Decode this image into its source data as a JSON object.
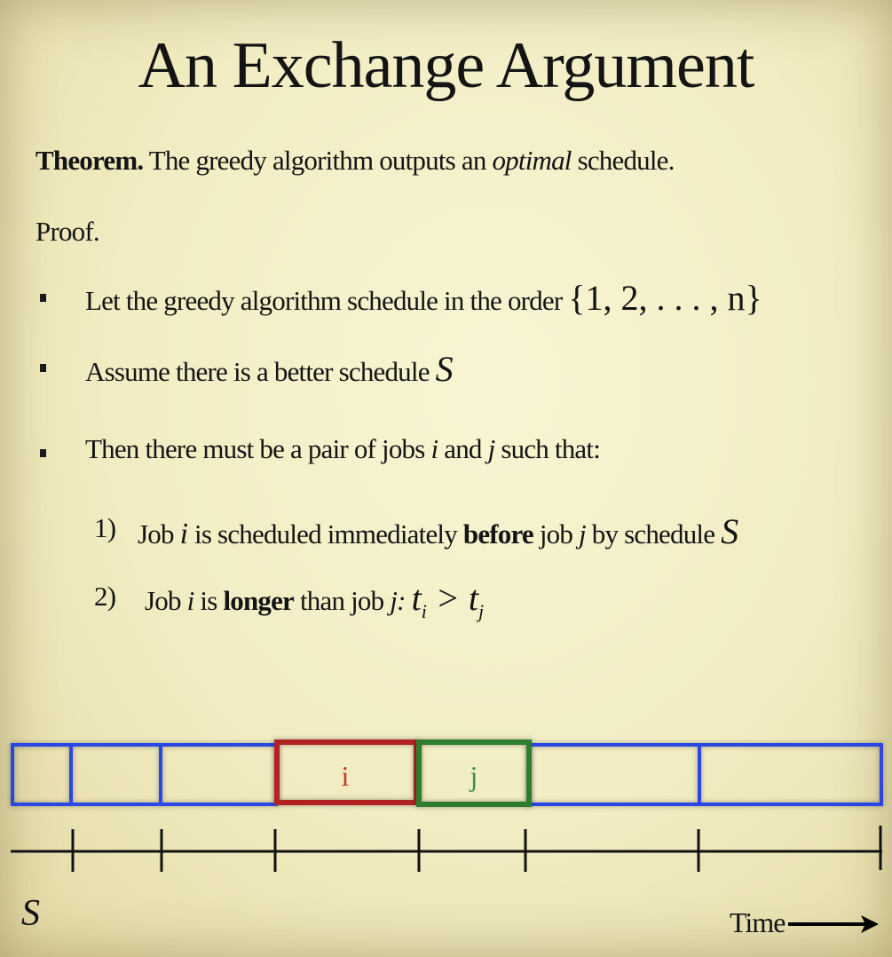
{
  "title": "An Exchange Argument",
  "theorem": {
    "label": "Theorem.",
    "text_before": "The greedy algorithm outputs an",
    "emphasis": "optimal",
    "text_after": "schedule."
  },
  "proof_label": "Proof.",
  "bullets": [
    {
      "text": "Let the greedy algorithm schedule in the order",
      "math": "{1, 2, . . . , n}"
    },
    {
      "text": "Assume there is a better schedule",
      "math": "S"
    },
    {
      "text": "Then there must be a pair of jobs",
      "var_i": "i",
      "and": "and",
      "var_j": "j",
      "tail": "such that:"
    }
  ],
  "numbered": [
    {
      "num": "1)",
      "job": "Job",
      "i": "i",
      "mid": "is scheduled immediately",
      "bold": "before",
      "after": "job",
      "j": "j",
      "by": "by schedule",
      "S": "S"
    },
    {
      "num": "2)",
      "job": "Job",
      "i": "i",
      "is": "is",
      "bold": "longer",
      "than": "than job",
      "j": "j:",
      "math": "t_i > t_j"
    }
  ],
  "timeline": {
    "job_i_label": "i",
    "job_j_label": "j",
    "schedule_label": "S",
    "time_label": "Time",
    "colors": {
      "blue": "#2a47e6",
      "red": "#b12121",
      "green": "#2e7d2e",
      "axis": "#111111"
    }
  }
}
